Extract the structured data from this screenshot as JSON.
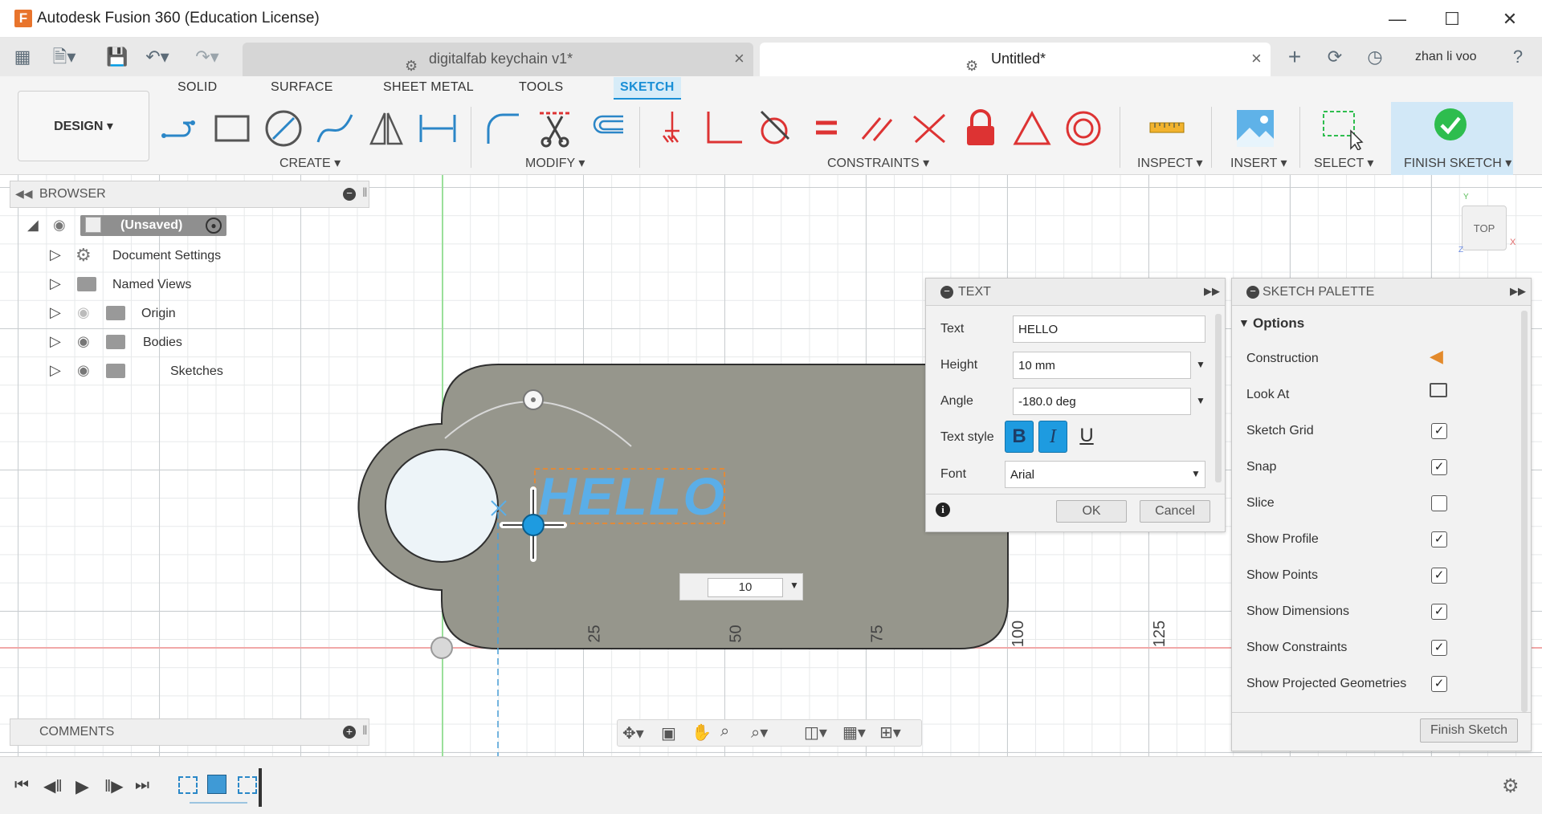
{
  "window": {
    "title": "Autodesk Fusion 360 (Education License)",
    "app_icon": "F"
  },
  "tabs": [
    {
      "label": "digitalfab keychain v1*",
      "active": false
    },
    {
      "label": "Untitled*",
      "active": true
    }
  ],
  "user": "zhan li voo",
  "ribbon": {
    "workspace": "DESIGN",
    "tabs": [
      "SOLID",
      "SURFACE",
      "SHEET METAL",
      "TOOLS",
      "SKETCH"
    ],
    "groups": {
      "create": "CREATE",
      "modify": "MODIFY",
      "constraints": "CONSTRAINTS",
      "inspect": "INSPECT",
      "insert": "INSERT",
      "select": "SELECT",
      "finish": "FINISH SKETCH"
    }
  },
  "browser": {
    "title": "BROWSER",
    "root": "(Unsaved)",
    "items": [
      "Document Settings",
      "Named Views",
      "Origin",
      "Bodies",
      "Sketches"
    ]
  },
  "comments": {
    "title": "COMMENTS"
  },
  "viewcube": {
    "label": "TOP",
    "axis_y": "Y",
    "axis_x": "X",
    "axis_z": "Z"
  },
  "canvas": {
    "sketch_text": "HELLO",
    "dimension_value": "10",
    "ruler_labels": [
      "25",
      "50",
      "75",
      "100",
      "125"
    ]
  },
  "text_dialog": {
    "title": "TEXT",
    "text_label": "Text",
    "text_value": "HELLO",
    "height_label": "Height",
    "height_value": "10 mm",
    "angle_label": "Angle",
    "angle_value": "-180.0 deg",
    "style_label": "Text style",
    "bold": "B",
    "italic": "I",
    "underline": "U",
    "font_label": "Font",
    "font_value": "Arial",
    "ok": "OK",
    "cancel": "Cancel"
  },
  "sketch_palette": {
    "title": "SKETCH PALETTE",
    "section": "Options",
    "rows": [
      {
        "label": "Construction",
        "type": "icon"
      },
      {
        "label": "Look At",
        "type": "icon"
      },
      {
        "label": "Sketch Grid",
        "type": "check",
        "checked": true
      },
      {
        "label": "Snap",
        "type": "check",
        "checked": true
      },
      {
        "label": "Slice",
        "type": "check",
        "checked": false
      },
      {
        "label": "Show Profile",
        "type": "check",
        "checked": true
      },
      {
        "label": "Show Points",
        "type": "check",
        "checked": true
      },
      {
        "label": "Show Dimensions",
        "type": "check",
        "checked": true
      },
      {
        "label": "Show Constraints",
        "type": "check",
        "checked": true
      },
      {
        "label": "Show Projected Geometries",
        "type": "check",
        "checked": true
      }
    ],
    "finish_button": "Finish Sketch"
  },
  "colors": {
    "accent": "#1a8fd6",
    "body_fill": "#96968c",
    "sketch_text": "#5aaee8",
    "finish_green": "#2ebd4e"
  }
}
